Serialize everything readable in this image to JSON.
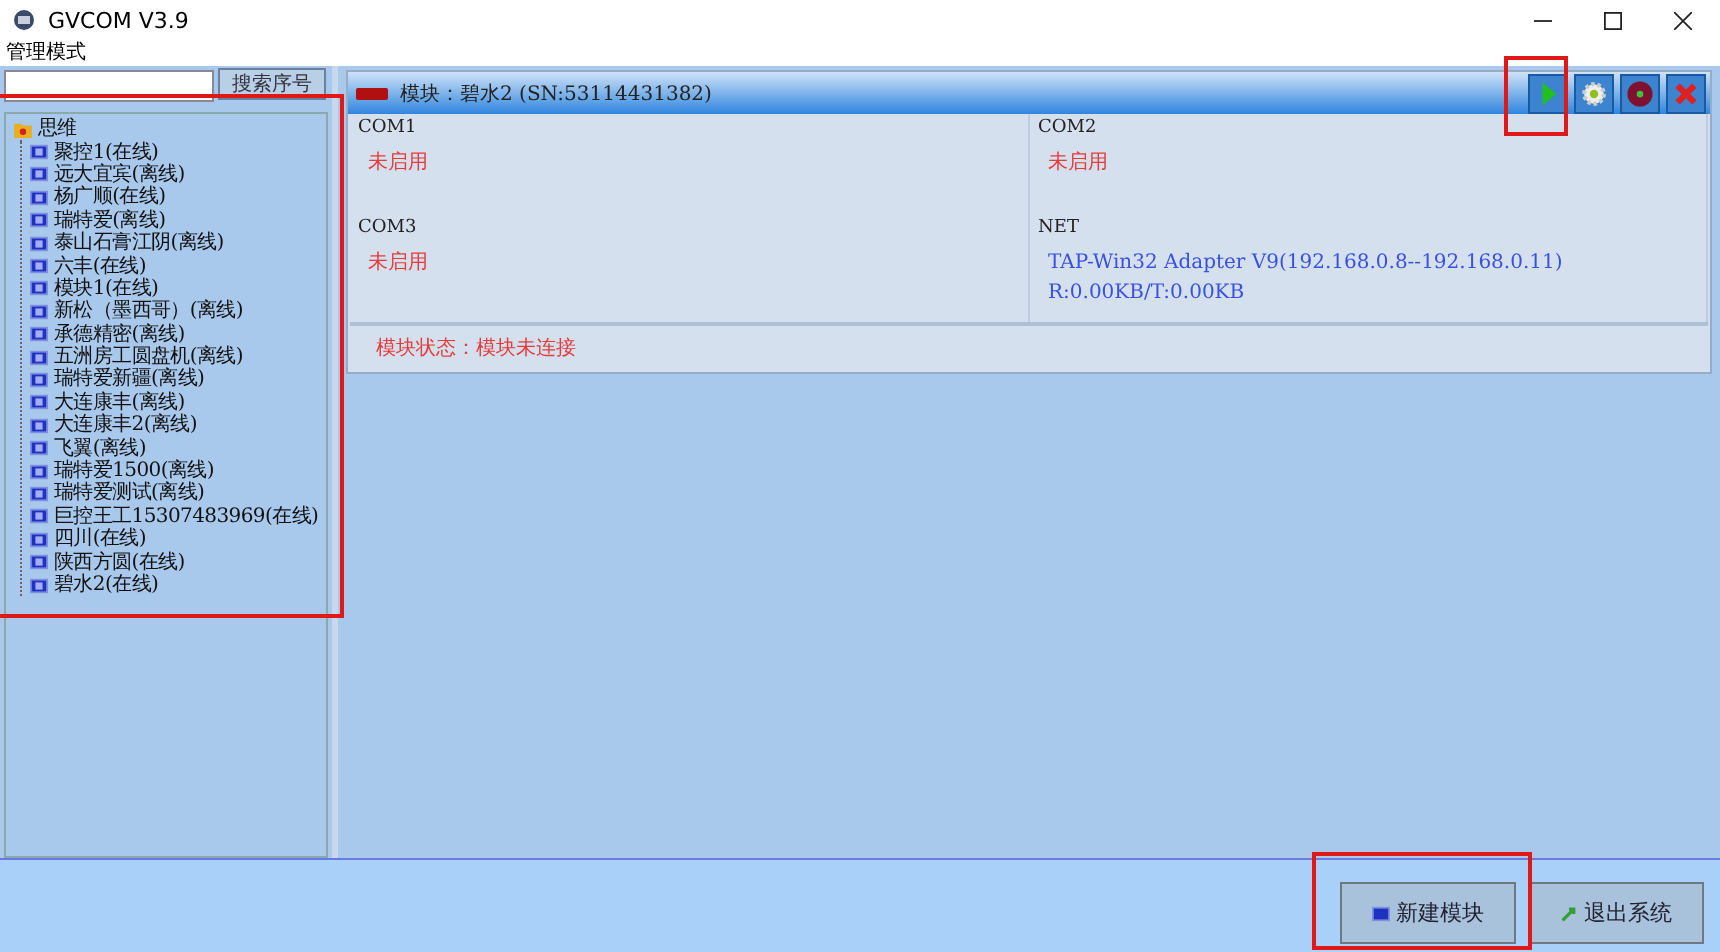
{
  "window": {
    "title": "GVCOM  V3.9"
  },
  "menu": [
    "管理模式"
  ],
  "search": {
    "button": "搜索序号"
  },
  "tree": [
    {
      "label": "思维",
      "expanded": true,
      "children": [
        {
          "label": "聚控1(在线)"
        },
        {
          "label": "远大宜宾(离线)"
        },
        {
          "label": "杨广顺(在线)"
        },
        {
          "label": "瑞特爱(离线)"
        },
        {
          "label": "泰山石膏江阴(离线)"
        },
        {
          "label": "六丰(在线)"
        },
        {
          "label": "模块1(在线)"
        },
        {
          "label": "新松（墨西哥）(离线)"
        },
        {
          "label": "承德精密(离线)"
        },
        {
          "label": "五洲房工圆盘机(离线)"
        },
        {
          "label": "瑞特爱新疆(离线)"
        },
        {
          "label": "大连康丰(离线)"
        },
        {
          "label": "大连康丰2(离线)"
        },
        {
          "label": "飞翼(离线)"
        },
        {
          "label": "瑞特爱1500(离线)"
        },
        {
          "label": "瑞特爱测试(离线)"
        },
        {
          "label": "巨控王工15307483969(在线)"
        },
        {
          "label": "四川(在线)"
        },
        {
          "label": "陕西方圆(在线)"
        },
        {
          "label": "碧水2(在线)"
        }
      ]
    }
  ],
  "module": {
    "title": "模块：碧水2 (SN:53114431382)",
    "ports": [
      {
        "name": "COM1",
        "kind": "error",
        "lines": [
          "未启用"
        ]
      },
      {
        "name": "COM2",
        "kind": "error",
        "lines": [
          "未启用"
        ]
      },
      {
        "name": "COM3",
        "kind": "error",
        "lines": [
          "未启用"
        ]
      },
      {
        "name": "NET",
        "kind": "info",
        "lines": [
          "TAP-Win32 Adapter V9(192.168.0.8--192.168.0.11)",
          "R:0.00KB/T:0.00KB"
        ]
      }
    ],
    "status": "模块状态：模块未连接"
  },
  "buttons": [
    {
      "label": "新建模块",
      "kind": "new"
    },
    {
      "label": "退出系统",
      "kind": "exit"
    }
  ]
}
